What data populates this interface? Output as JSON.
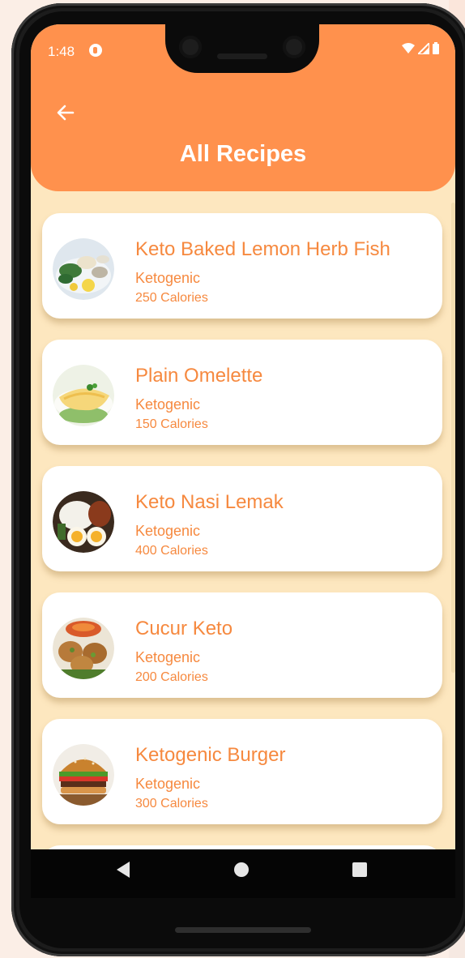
{
  "status_bar": {
    "time": "1:48"
  },
  "header": {
    "title": "All Recipes",
    "back_icon": "arrow-left-icon"
  },
  "recipes": [
    {
      "name": "Keto Baked Lemon Herb Fish",
      "diet": "Ketogenic",
      "calories": "250 Calories"
    },
    {
      "name": "Plain Omelette",
      "diet": "Ketogenic",
      "calories": "150 Calories"
    },
    {
      "name": "Keto Nasi Lemak",
      "diet": "Ketogenic",
      "calories": "400 Calories"
    },
    {
      "name": "Cucur Keto",
      "diet": "Ketogenic",
      "calories": "200 Calories"
    },
    {
      "name": "Ketogenic Burger",
      "diet": "Ketogenic",
      "calories": "300 Calories"
    }
  ],
  "nav": {
    "back_icon": "triangle-back-icon",
    "home_icon": "circle-home-icon",
    "recents_icon": "square-recents-icon"
  },
  "colors": {
    "accent": "#ff914d",
    "background": "#fde7bf",
    "card": "#ffffff"
  }
}
